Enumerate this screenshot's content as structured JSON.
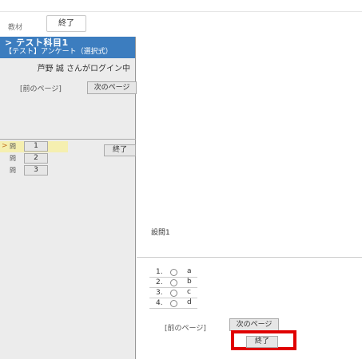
{
  "topbar": {
    "label": "教材",
    "end_button": "終了"
  },
  "course": {
    "title": "> テスト科目1",
    "subtitle": "【テスト】アンケート（選択式）",
    "user_login": "芦野 誠 さんがログイン中"
  },
  "left_pager": {
    "prev": "[前のページ]",
    "next": "次のページ",
    "end": "終了"
  },
  "questions": [
    {
      "marker": ">",
      "label": "問",
      "number": "1",
      "active": true
    },
    {
      "marker": "",
      "label": "問",
      "number": "2",
      "active": false
    },
    {
      "marker": "",
      "label": "問",
      "number": "3",
      "active": false
    }
  ],
  "main": {
    "question_title": "設問1",
    "choices": [
      {
        "num": "1.",
        "label": "a"
      },
      {
        "num": "2.",
        "label": "b"
      },
      {
        "num": "3.",
        "label": "c"
      },
      {
        "num": "4.",
        "label": "d"
      }
    ],
    "prev": "[前のページ]",
    "next": "次のページ",
    "end": "終了"
  },
  "colors": {
    "course_header": "#3c7dbf",
    "active_question": "#f5efb0",
    "highlight": "#e00000"
  }
}
